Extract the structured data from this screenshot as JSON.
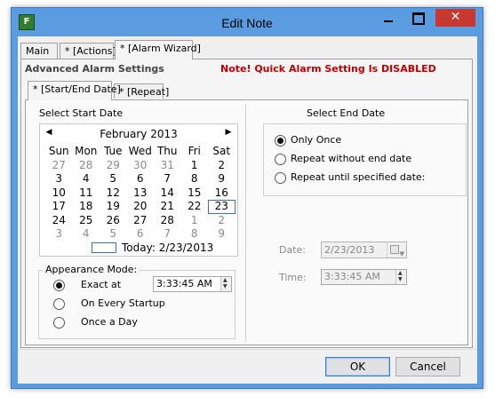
{
  "window": {
    "title": "Edit Note",
    "icon_text": "F",
    "controls": {
      "minimize": "",
      "maximize": "",
      "close": "✕"
    }
  },
  "tabs": [
    "Main",
    "* [Actions]",
    "* [Alarm Wizard]"
  ],
  "active_tab": "* [Alarm Wizard]",
  "section_title": "Advanced Alarm Settings",
  "note_text": "Note! Quick Alarm Setting Is DISABLED",
  "subtabs": [
    "* [Start/End Date]",
    "* [Repeat]"
  ],
  "start": {
    "label": "Select Start Date",
    "calendar": {
      "prev": "◀",
      "next": "▶",
      "month": "February 2013",
      "weekdays": [
        "Sun",
        "Mon",
        "Tue",
        "Wed",
        "Thu",
        "Fri",
        "Sat"
      ],
      "weeks": [
        [
          "27",
          "28",
          "29",
          "30",
          "31",
          "1",
          "2"
        ],
        [
          "3",
          "4",
          "5",
          "6",
          "7",
          "8",
          "9"
        ],
        [
          "10",
          "11",
          "12",
          "13",
          "14",
          "15",
          "16"
        ],
        [
          "17",
          "18",
          "19",
          "20",
          "21",
          "22",
          "23"
        ],
        [
          "24",
          "25",
          "26",
          "27",
          "28",
          "1",
          "2"
        ],
        [
          "3",
          "4",
          "5",
          "6",
          "7",
          "8",
          "9"
        ]
      ],
      "selected_day": "23",
      "today_label": "Today: 2/23/2013"
    },
    "appearance": {
      "title": "Appearance Mode:",
      "options": [
        "Exact at",
        "On Every Startup",
        "Once a Day"
      ],
      "selected": "Exact at",
      "time_value": "3:33:45 AM"
    }
  },
  "end": {
    "label": "Select End Date",
    "options": [
      "Only Once",
      "Repeat without end date",
      "Repeat until specified date:"
    ],
    "selected": "Only Once",
    "date_label": "Date:",
    "date_value": "2/23/2013",
    "time_label": "Time:",
    "time_value": "3:33:45 AM"
  },
  "buttons": {
    "ok": "OK",
    "cancel": "Cancel"
  },
  "colors": {
    "titlebar": "#5b9be0",
    "close": "#c7392f",
    "note": "#c00000",
    "accent": "#3c7fd1"
  }
}
